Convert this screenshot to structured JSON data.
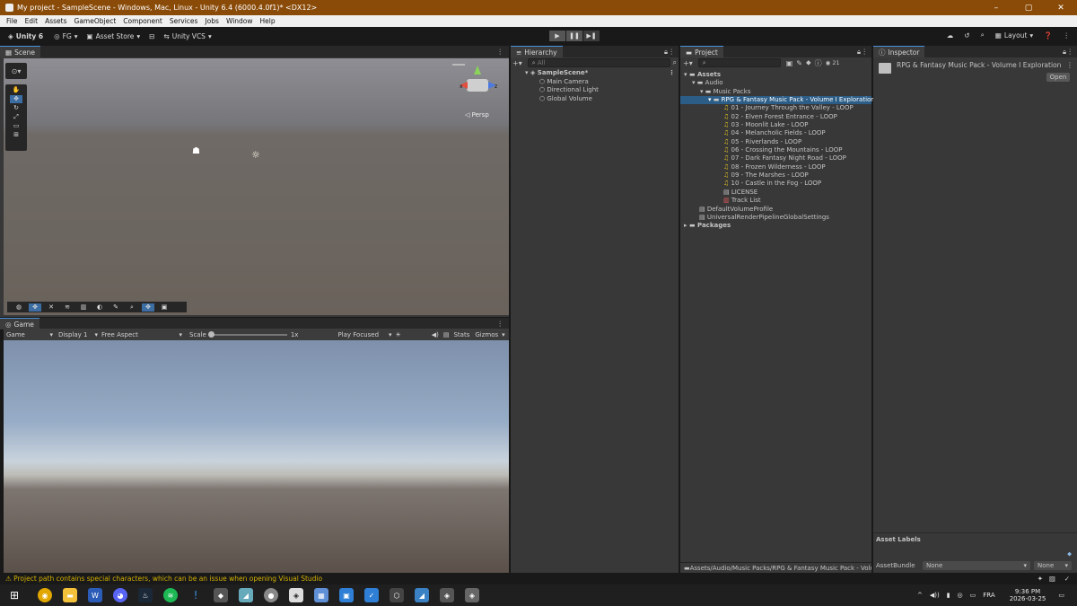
{
  "window": {
    "title": "My project - SampleScene - Windows, Mac, Linux - Unity 6.4 (6000.4.0f1)* <DX12>",
    "controls": [
      "–",
      "▢",
      "✕"
    ]
  },
  "menu": [
    "File",
    "Edit",
    "Assets",
    "GameObject",
    "Component",
    "Services",
    "Jobs",
    "Window",
    "Help"
  ],
  "toolbar": {
    "unity_label": "Unity 6",
    "account": "FG",
    "asset_store": "Asset Store",
    "vcs": "Unity VCS",
    "layout": "Layout"
  },
  "scene": {
    "tab": "Scene",
    "persp": "◁ Persp"
  },
  "game": {
    "tab": "Game",
    "mode": "Game",
    "display": "Display 1",
    "aspect": "Free Aspect",
    "scale_label": "Scale",
    "scale_value": "1x",
    "play_focused": "Play Focused",
    "stats": "Stats",
    "gizmos": "Gizmos"
  },
  "hierarchy": {
    "tab": "Hierarchy",
    "search_placeholder": "All",
    "scene": "SampleScene*",
    "items": [
      "Main Camera",
      "Directional Light",
      "Global Volume"
    ]
  },
  "project": {
    "tab": "Project",
    "visible_count": "21",
    "tree": [
      {
        "label": "Assets",
        "indent": 0,
        "type": "folder",
        "bold": true
      },
      {
        "label": "Audio",
        "indent": 1,
        "type": "folder"
      },
      {
        "label": "Music Packs",
        "indent": 2,
        "type": "folder"
      },
      {
        "label": "RPG & Fantasy Music Pack - Volume I Exploration",
        "indent": 3,
        "type": "folder",
        "selected": true
      },
      {
        "label": "01 - Journey Through the Valley - LOOP",
        "indent": 4,
        "type": "music"
      },
      {
        "label": "02 - Elven Forest Entrance - LOOP",
        "indent": 4,
        "type": "music"
      },
      {
        "label": "03 - Moonlit Lake - LOOP",
        "indent": 4,
        "type": "music"
      },
      {
        "label": "04 - Melancholic Fields - LOOP",
        "indent": 4,
        "type": "music"
      },
      {
        "label": "05 - Riverlands - LOOP",
        "indent": 4,
        "type": "music"
      },
      {
        "label": "06 - Crossing the Mountains - LOOP",
        "indent": 4,
        "type": "music"
      },
      {
        "label": "07 - Dark Fantasy Night Road - LOOP",
        "indent": 4,
        "type": "music"
      },
      {
        "label": "08 - Frozen Wilderness - LOOP",
        "indent": 4,
        "type": "music"
      },
      {
        "label": "09 - The Marshes - LOOP",
        "indent": 4,
        "type": "music"
      },
      {
        "label": "10 - Castle in the Fog - LOOP",
        "indent": 4,
        "type": "music"
      },
      {
        "label": "LICENSE",
        "indent": 4,
        "type": "doc"
      },
      {
        "label": "Track List",
        "indent": 4,
        "type": "pdf"
      },
      {
        "label": "DefaultVolumeProfile",
        "indent": 1,
        "type": "asset"
      },
      {
        "label": "UniversalRenderPipelineGlobalSettings",
        "indent": 1,
        "type": "asset"
      },
      {
        "label": "Packages",
        "indent": 0,
        "type": "folder",
        "bold": true
      }
    ],
    "path": "Assets/Audio/Music Packs/RPG & Fantasy Music Pack - Volu"
  },
  "inspector": {
    "tab": "Inspector",
    "title": "RPG & Fantasy Music Pack - Volume I Exploration",
    "open_button": "Open",
    "asset_labels": "Asset Labels",
    "asset_bundle": "AssetBundle",
    "bundle_value": "None",
    "variant_value": "None"
  },
  "status": {
    "message": "Project path contains special characters, which can be an issue when opening Visual Studio"
  },
  "taskbar": {
    "time": "9:36 PM",
    "date": "2026-03-25",
    "lang": "FRA"
  },
  "colors": {
    "titlebar": "#8a4b08",
    "selection": "#2c5d87",
    "warning": "#d5b100"
  }
}
